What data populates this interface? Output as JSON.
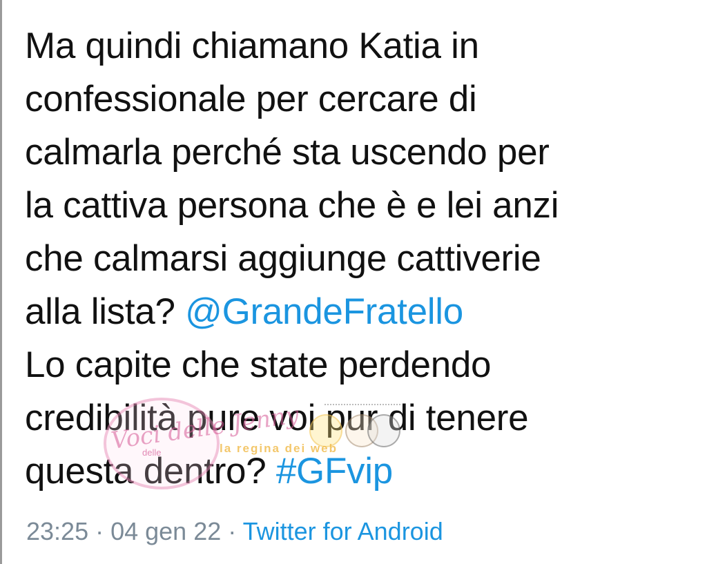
{
  "tweet": {
    "lines": [
      [
        "Ma quindi chiamano Katia in"
      ],
      [
        "confessionale per cercare di"
      ],
      [
        "calmarla perché sta uscendo per"
      ],
      [
        "la cattiva persona che è e lei anzi"
      ],
      [
        "che calmarsi aggiunge cattiverie"
      ],
      [
        "alla lista? ",
        "@GrandeFratello"
      ],
      [
        "Lo capite che state perdendo"
      ],
      [
        "credibilità pure voi pur di tenere"
      ],
      [
        "questa dentro? ",
        "#GFvip"
      ]
    ],
    "mention": "@GrandeFratello",
    "hashtag": "#GFvip"
  },
  "meta": {
    "time": "23:25",
    "separator": " · ",
    "date": "04 gen 22",
    "source": "Twitter for Android"
  },
  "watermark": {
    "script": "Voci delle Jenny",
    "small": "delle",
    "banner": "la regina dei web"
  },
  "colors": {
    "text": "#111111",
    "link": "#1b95e0",
    "meta": "#7b8a97",
    "background": "#ffffff"
  }
}
